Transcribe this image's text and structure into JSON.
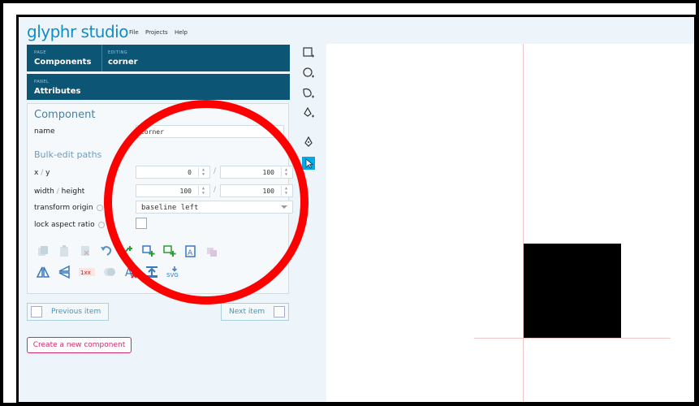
{
  "app": {
    "logo": "glyphr studio",
    "menu": [
      "File",
      "Projects",
      "Help"
    ]
  },
  "nav": {
    "page_caption": "PAGE",
    "page_value": "Components",
    "editing_caption": "EDITING",
    "editing_value": "corner",
    "panel_caption": "PANEL",
    "panel_value": "Attributes"
  },
  "component": {
    "heading": "Component",
    "name_label": "name",
    "name_value": "corner"
  },
  "bulk": {
    "heading": "Bulk-edit paths",
    "xy_label_x": "x",
    "xy_label_sep": "/",
    "xy_label_y": "y",
    "x_value": "0",
    "y_value": "100",
    "wh_label_w": "width",
    "wh_label_sep": "/",
    "wh_label_h": "height",
    "width_value": "100",
    "height_value": "100",
    "field_sep": "/",
    "origin_label": "transform origin",
    "origin_value": "baseline left",
    "lock_label": "lock aspect ratio",
    "lock_checked": false
  },
  "actions_row1": [
    "copy-icon",
    "paste-icon",
    "delete-icon",
    "undo-icon",
    "add-path-point-icon",
    "add-shape-icon",
    "add-shape-green-icon",
    "add-shape-clipboard-icon",
    "duplicate-icon"
  ],
  "actions_row2": [
    "flip-vertical-icon",
    "flip-horizontal-icon",
    "remove-kern-icon",
    "combine-icon",
    "clear-text-format-icon",
    "align-top-icon",
    "export-svg-icon"
  ],
  "actions_row2_text": {
    "kern": "1xx",
    "svg": "SVG"
  },
  "pager": {
    "prev": "Previous item",
    "next": "Next item"
  },
  "create_label": "Create a new component",
  "toolbar": [
    "rectangle-tool-icon",
    "oval-tool-icon",
    "path-tool-icon",
    "pen-add-tool-icon",
    "pen-tool-icon",
    "pointer-tool-icon"
  ],
  "colors": {
    "brand": "#0f8ec8",
    "nav": "#0d5575",
    "accent": "#00a9e8",
    "create": "#d02a6a"
  }
}
